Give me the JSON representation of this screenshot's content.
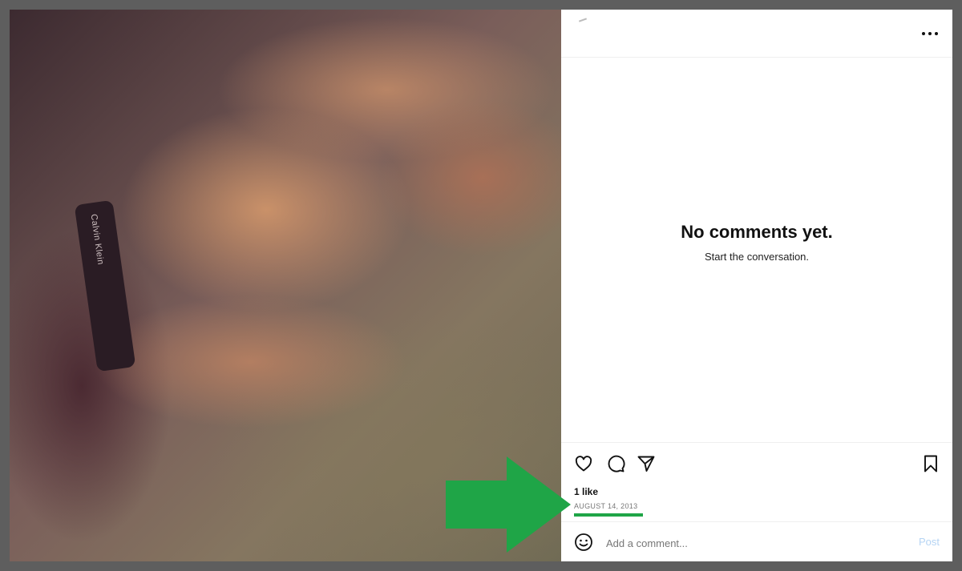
{
  "post": {
    "photo_credit": "Calvin Klein"
  },
  "panel": {
    "more_icon": "more-horizontal-icon",
    "empty_title": "No comments yet.",
    "empty_subtitle": "Start the conversation.",
    "likes": "1 like",
    "date": "AUGUST 14, 2013",
    "comment_placeholder": "Add a comment...",
    "post_label": "Post",
    "icons": [
      "heart-icon",
      "comment-icon",
      "share-icon",
      "bookmark-icon",
      "emoji-icon"
    ]
  },
  "annotation": {
    "arrow_color": "#1fa547",
    "underline_color": "#1fa547"
  }
}
